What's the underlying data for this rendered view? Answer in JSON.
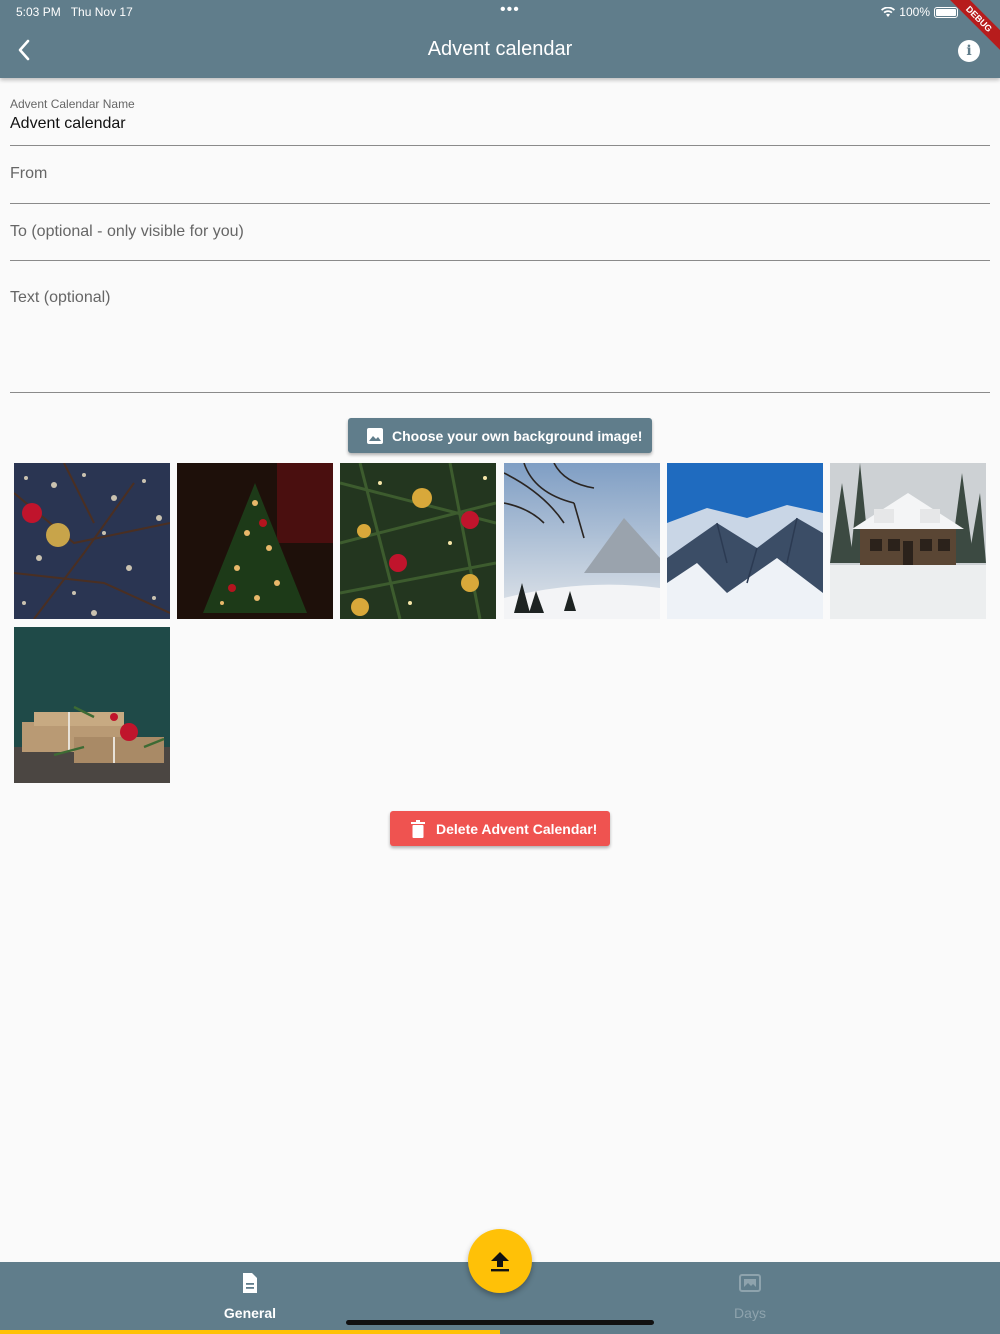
{
  "status_bar": {
    "time": "5:03 PM",
    "date": "Thu Nov 17",
    "battery": "100%",
    "debug": "DEBUG"
  },
  "app_bar": {
    "title": "Advent calendar",
    "back_icon": "chevron-left-icon",
    "info_icon": "info-icon"
  },
  "form": {
    "name_label": "Advent Calendar Name",
    "name_value": "Advent calendar",
    "from_placeholder": "From",
    "to_placeholder": "To (optional - only visible for you)",
    "text_placeholder": "Text (optional)"
  },
  "choose_button": {
    "label": "Choose your own background image!",
    "icon": "image-icon"
  },
  "backgrounds": [
    "bokeh-branches-ornaments",
    "christmas-tree-dark-room",
    "christmas-tree-ornaments-closeup",
    "winter-branches-mountain",
    "snowy-mountain-range",
    "snowy-house",
    "gift-packages-ornaments"
  ],
  "delete_button": {
    "label": "Delete Advent Calendar!",
    "icon": "trash-icon"
  },
  "fab": {
    "icon": "upload-icon"
  },
  "bottom_nav": {
    "tabs": [
      {
        "label": "General",
        "icon": "document-icon",
        "active": true
      },
      {
        "label": "Days",
        "icon": "image-frame-icon",
        "active": false
      }
    ]
  },
  "colors": {
    "primary": "#607d8b",
    "accent": "#ffc107",
    "danger": "#ef5350",
    "background": "#fafafa"
  }
}
